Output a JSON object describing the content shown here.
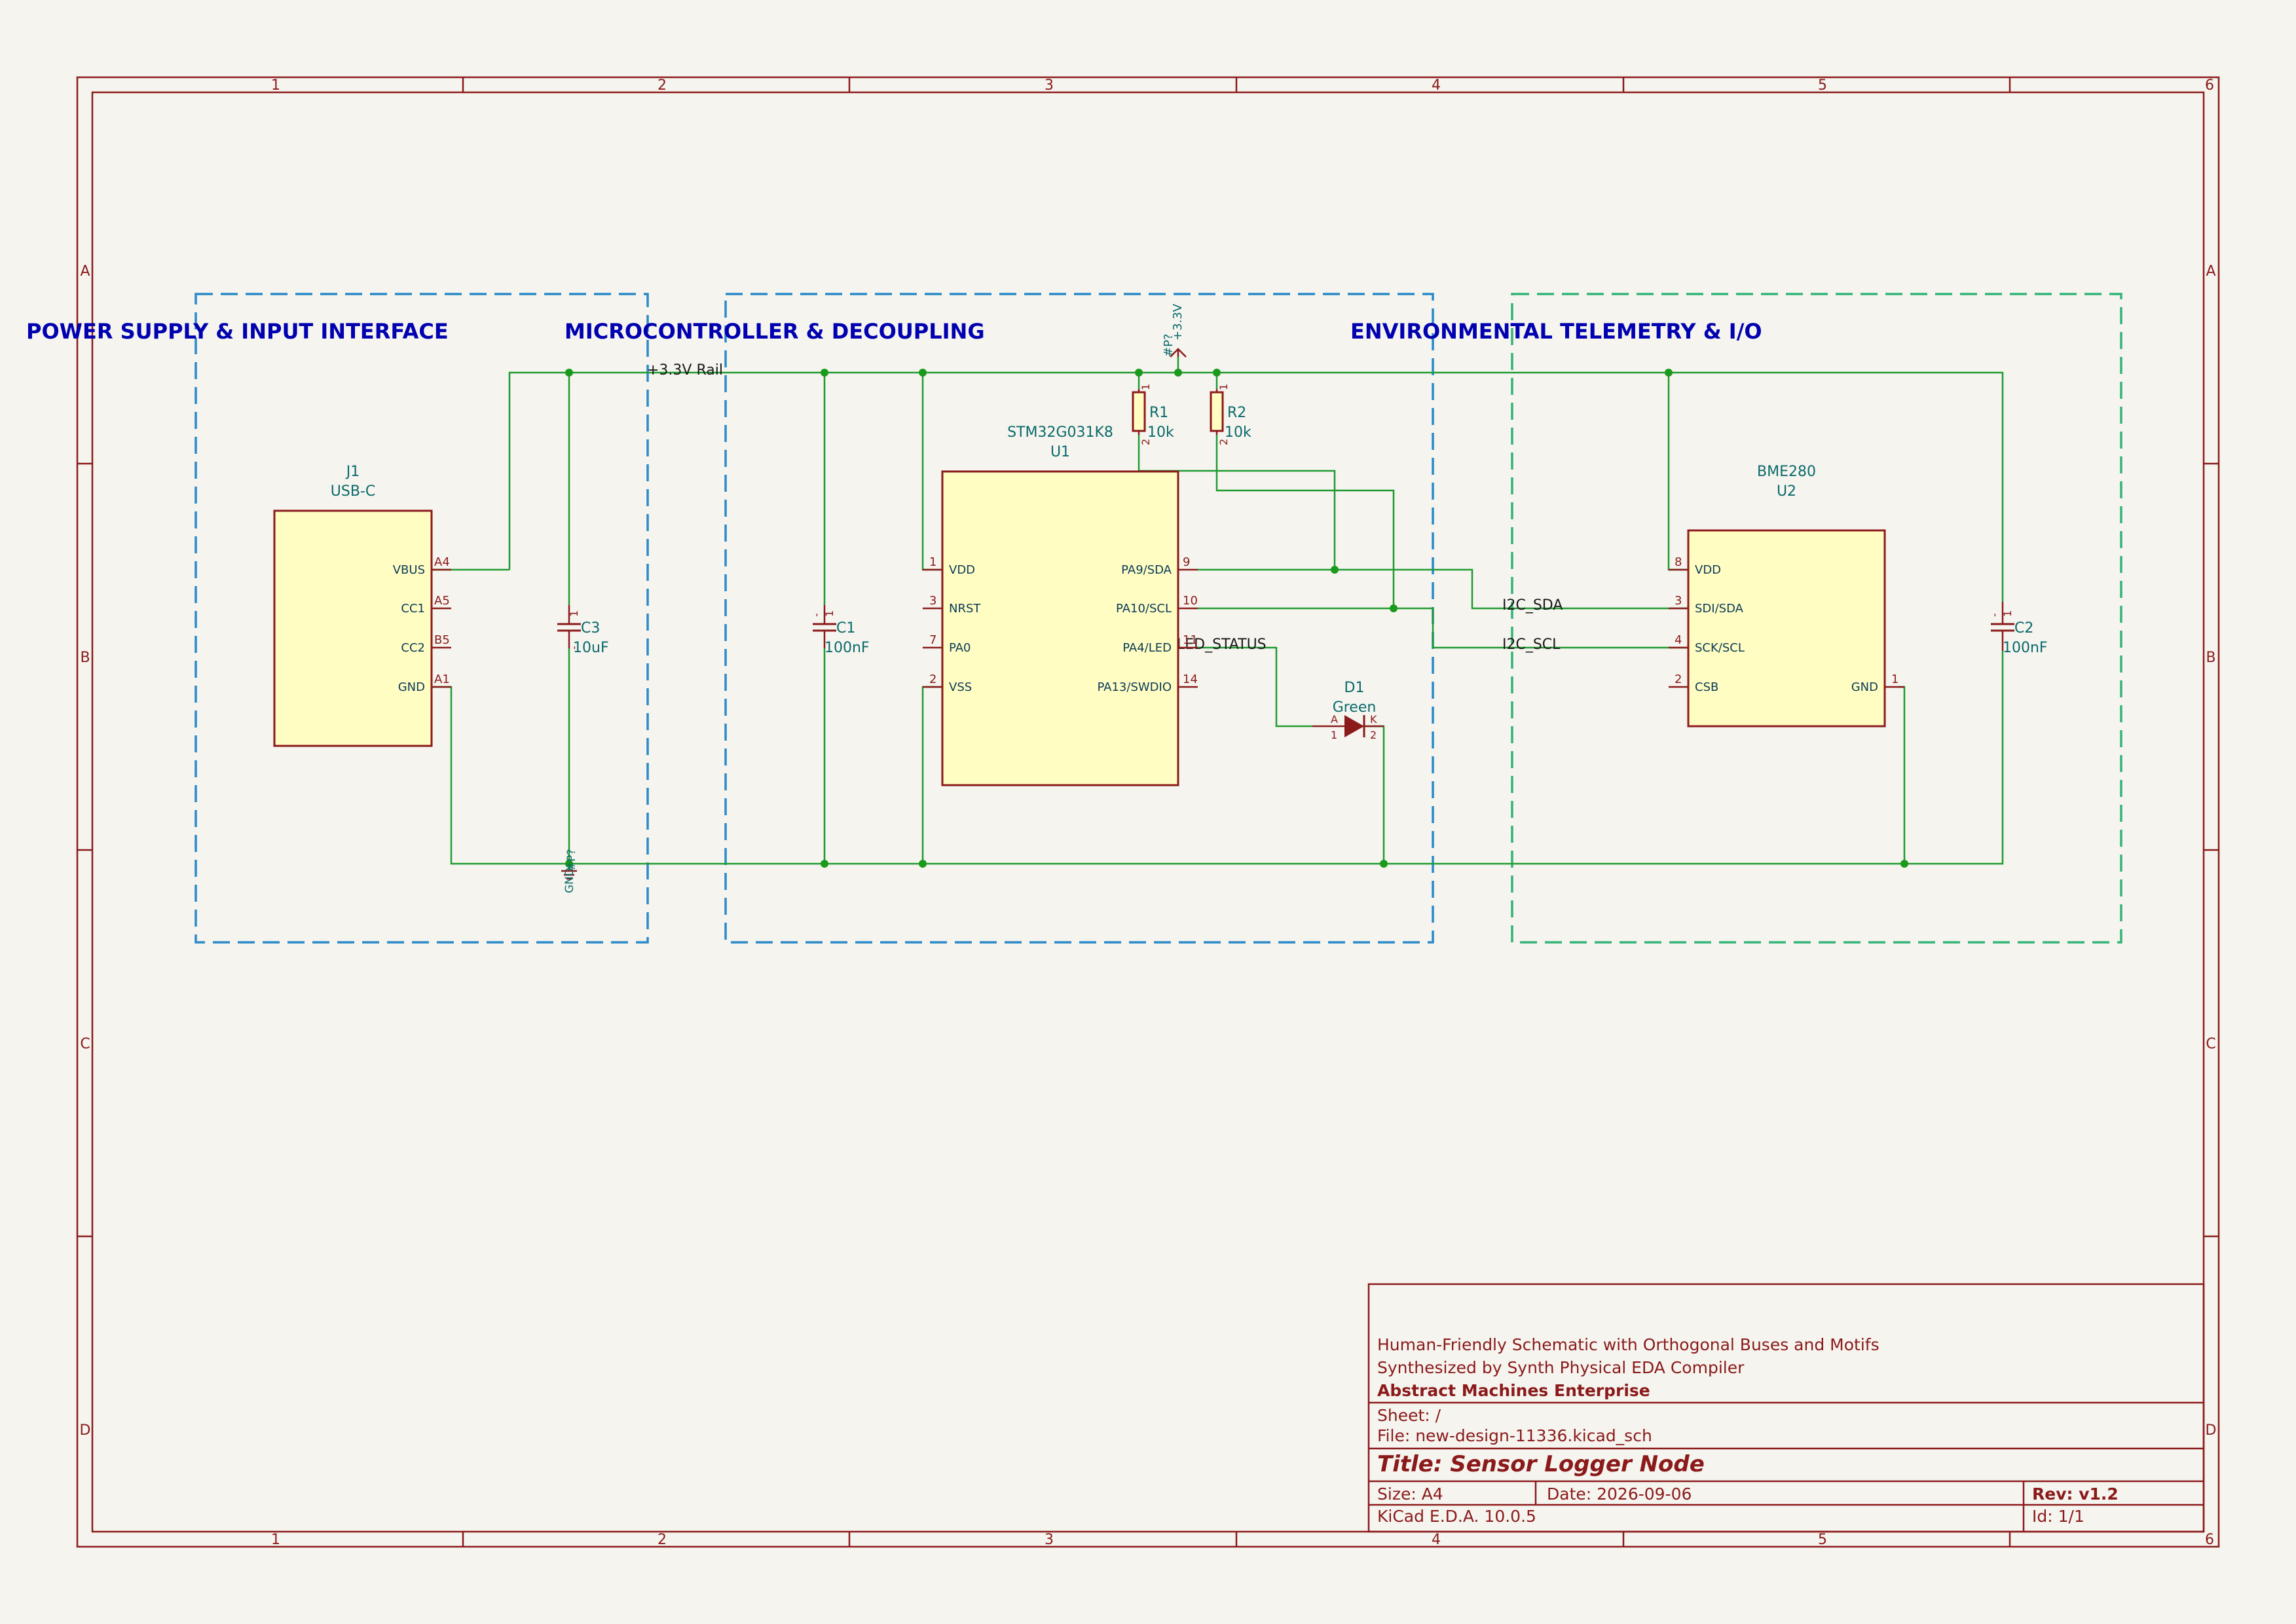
{
  "frame": {
    "columns": [
      "1",
      "2",
      "3",
      "4",
      "5",
      "6"
    ],
    "rows": [
      "A",
      "B",
      "C",
      "D"
    ]
  },
  "sections": {
    "power": "POWER SUPPLY & INPUT INTERFACE",
    "mcu": "MICROCONTROLLER & DECOUPLING",
    "env": "ENVIRONMENTAL TELEMETRY & I/O"
  },
  "nets": {
    "rail_label": "+3.3V Rail",
    "power_symbol": "+3.3V",
    "power_symbol_ref": "#P?",
    "gnd_symbol_ref": "#P?",
    "gnd_symbol": "GND",
    "i2c_sda": "I2C_SDA",
    "i2c_scl": "I2C_SCL",
    "led_status": "LED_STATUS"
  },
  "components": {
    "j1": {
      "ref": "J1",
      "value": "USB-C",
      "pins": [
        {
          "name": "VBUS",
          "num": "A4"
        },
        {
          "name": "CC1",
          "num": "A5"
        },
        {
          "name": "CC2",
          "num": "B5"
        },
        {
          "name": "GND",
          "num": "A1"
        }
      ]
    },
    "u1": {
      "ref": "U1",
      "value": "STM32G031K8",
      "left_pins": [
        {
          "name": "VDD",
          "num": "1"
        },
        {
          "name": "NRST",
          "num": "3"
        },
        {
          "name": "PA0",
          "num": "7"
        },
        {
          "name": "VSS",
          "num": "2"
        }
      ],
      "right_pins": [
        {
          "name": "PA9/SDA",
          "num": "9"
        },
        {
          "name": "PA10/SCL",
          "num": "10"
        },
        {
          "name": "PA4/LED",
          "num": "11"
        },
        {
          "name": "PA13/SWDIO",
          "num": "14"
        }
      ]
    },
    "u2": {
      "ref": "U2",
      "value": "BME280",
      "left_pins": [
        {
          "name": "VDD",
          "num": "8"
        },
        {
          "name": "SDI/SDA",
          "num": "3"
        },
        {
          "name": "SCK/SCL",
          "num": "4"
        },
        {
          "name": "CSB",
          "num": "2"
        }
      ],
      "right_pins": [
        {
          "name": "GND",
          "num": "1"
        }
      ]
    },
    "c1": {
      "ref": "C1",
      "value": "100nF",
      "pin1": "1",
      "pin2": "-"
    },
    "c2": {
      "ref": "C2",
      "value": "100nF",
      "pin1": "1",
      "pin2": "-"
    },
    "c3": {
      "ref": "C3",
      "value": "10uF",
      "pin1": "1",
      "pin2": "-"
    },
    "r1": {
      "ref": "R1",
      "value": "10k",
      "pin1": "1",
      "pin2": "2"
    },
    "r2": {
      "ref": "R2",
      "value": "10k",
      "pin1": "1",
      "pin2": "2"
    },
    "d1": {
      "ref": "D1",
      "value": "Green",
      "anode": "A",
      "cathode": "K",
      "pin1": "1",
      "pin2": "2"
    }
  },
  "title_block": {
    "comment1": "Human-Friendly Schematic with Orthogonal Buses and Motifs",
    "comment2": "Synthesized by Synth Physical EDA Compiler",
    "company": "Abstract Machines Enterprise",
    "sheet": "Sheet: /",
    "file": "File: new-design-11336.kicad_sch",
    "title": "Title: Sensor Logger Node",
    "size": "Size: A4",
    "date": "Date: 2026-09-06",
    "rev": "Rev: v1.2",
    "tool": "KiCad E.D.A. 10.0.5",
    "id": "Id: 1/1"
  },
  "colors": {
    "background": "#f5f4ef",
    "frame": "#8b1a1a",
    "wire": "#1f9a2f",
    "junction": "#1a9a1a",
    "component_body": "#fffdc1",
    "component_outline": "#8b1a1a",
    "ref_text": "#0a6a6a",
    "section_text": "#0000b0",
    "box_blue": "#2a8ac8",
    "box_green": "#33b477",
    "label_text": "#1a1a1a"
  }
}
